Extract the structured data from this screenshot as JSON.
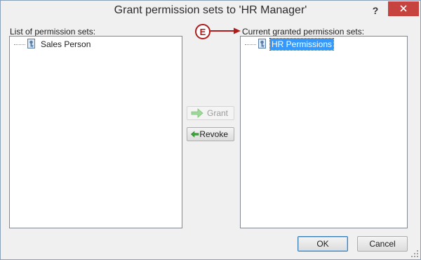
{
  "window": {
    "title": "Grant permission sets to 'HR Manager'",
    "help_glyph": "?"
  },
  "left_panel": {
    "label": "List of permission sets:",
    "items": [
      {
        "label": "Sales Person",
        "icon": "permission-set-icon"
      }
    ]
  },
  "right_panel": {
    "label": "Current granted permission sets:",
    "items": [
      {
        "label": "HR Permissions",
        "icon": "permission-set-icon",
        "selected": true
      }
    ]
  },
  "actions": {
    "grant_label": "Grant",
    "revoke_label": "Revoke",
    "grant_icon": "arrow-right-icon",
    "revoke_icon": "arrow-left-icon"
  },
  "footer": {
    "ok_label": "OK",
    "cancel_label": "Cancel"
  },
  "callout": {
    "letter": "E"
  },
  "colors": {
    "close_button": "#c7433f",
    "selection": "#3399ff",
    "callout": "#b01c1c",
    "grant_arrow": "#9fd89a",
    "revoke_arrow": "#3aa437"
  }
}
